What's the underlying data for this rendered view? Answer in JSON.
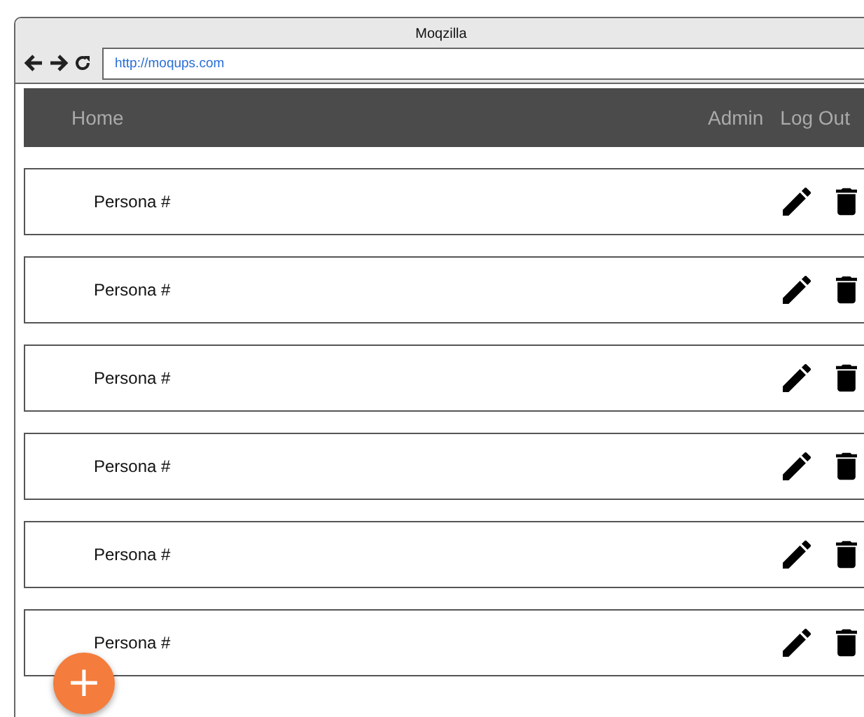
{
  "window": {
    "title": "Moqzilla"
  },
  "address_bar": {
    "value": "http://moqups.com"
  },
  "nav": {
    "left": [
      "Home"
    ],
    "right": [
      "Admin",
      "Log Out"
    ]
  },
  "personas": [
    {
      "name": "Persona #"
    },
    {
      "name": "Persona #"
    },
    {
      "name": "Persona #"
    },
    {
      "name": "Persona #"
    },
    {
      "name": "Persona #"
    },
    {
      "name": "Persona #"
    }
  ],
  "fab": {
    "label": "+"
  }
}
